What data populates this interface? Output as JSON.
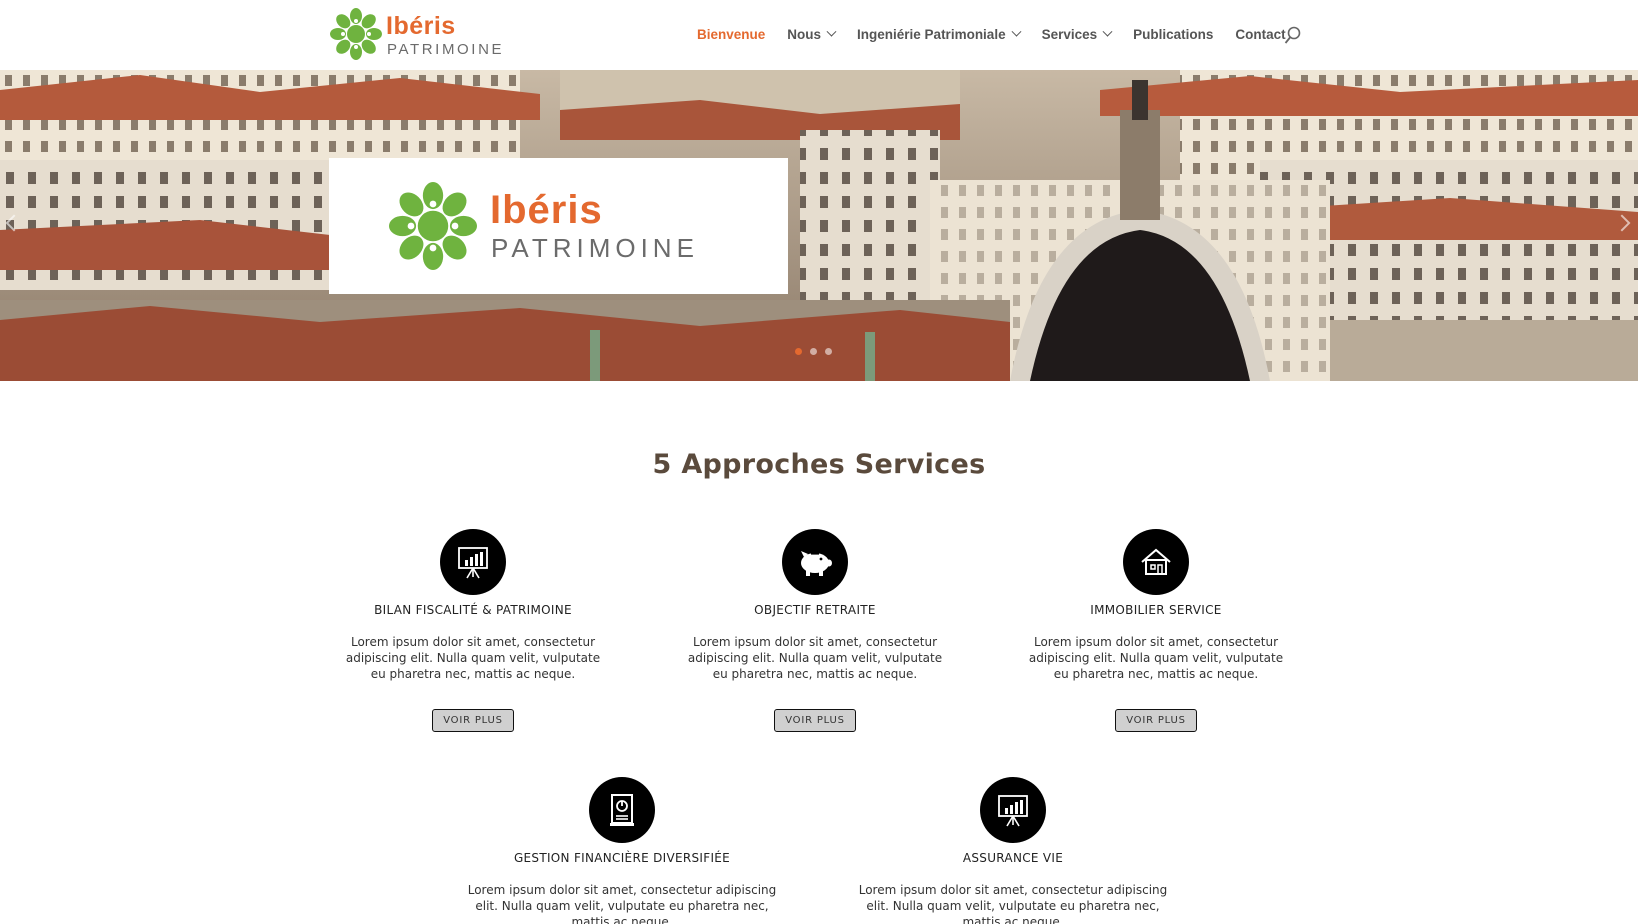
{
  "header": {
    "logo": {
      "brand": "Ibéris",
      "sub": "PATRIMOINE"
    },
    "nav": [
      {
        "label": "Bienvenue",
        "active": true,
        "dropdown": false
      },
      {
        "label": "Nous",
        "active": false,
        "dropdown": true
      },
      {
        "label": "Ingeniérie Patrimoniale",
        "active": false,
        "dropdown": true
      },
      {
        "label": "Services",
        "active": false,
        "dropdown": true
      },
      {
        "label": "Publications",
        "active": false,
        "dropdown": false
      },
      {
        "label": "Contact",
        "active": false,
        "dropdown": false
      }
    ],
    "search_icon": "search-icon"
  },
  "hero": {
    "card": {
      "brand": "Ibéris",
      "sub": "PATRIMOINE"
    },
    "slides": 3,
    "active_slide": 1
  },
  "section": {
    "title": "5 Approches Services",
    "cards": [
      {
        "icon": "presentation-chart-icon",
        "title": "BILAN FISCALITÉ & PATRIMOINE",
        "desc": "Lorem ipsum dolor sit amet, consectetur adipiscing elit. Nulla quam velit, vulputate eu pharetra nec, mattis ac neque.",
        "button": "VOIR PLUS"
      },
      {
        "icon": "piggy-bank-icon",
        "title": "OBJECTIF RETRAITE",
        "desc": "Lorem ipsum dolor sit amet, consectetur adipiscing elit. Nulla quam velit, vulputate eu pharetra nec, mattis ac neque.",
        "button": "VOIR PLUS"
      },
      {
        "icon": "house-icon",
        "title": "IMMOBILIER SERVICE",
        "desc": "Lorem ipsum dolor sit amet, consectetur adipiscing elit. Nulla quam velit, vulputate eu pharetra nec, mattis ac neque.",
        "button": "VOIR PLUS"
      },
      {
        "icon": "report-document-icon",
        "title": "GESTION FINANCIÈRE DIVERSIFIÉE",
        "desc": "Lorem ipsum dolor sit amet, consectetur adipiscing elit. Nulla quam velit, vulputate eu pharetra nec, mattis ac neque."
      },
      {
        "icon": "presentation-chart-icon",
        "title": "ASSURANCE VIE",
        "desc": "Lorem ipsum dolor sit amet, consectetur adipiscing elit. Nulla quam velit, vulputate eu pharetra nec, mattis ac neque."
      }
    ]
  },
  "colors": {
    "accent": "#e4692f",
    "logo_green": "#6fb33f",
    "nav_text": "#555555"
  }
}
